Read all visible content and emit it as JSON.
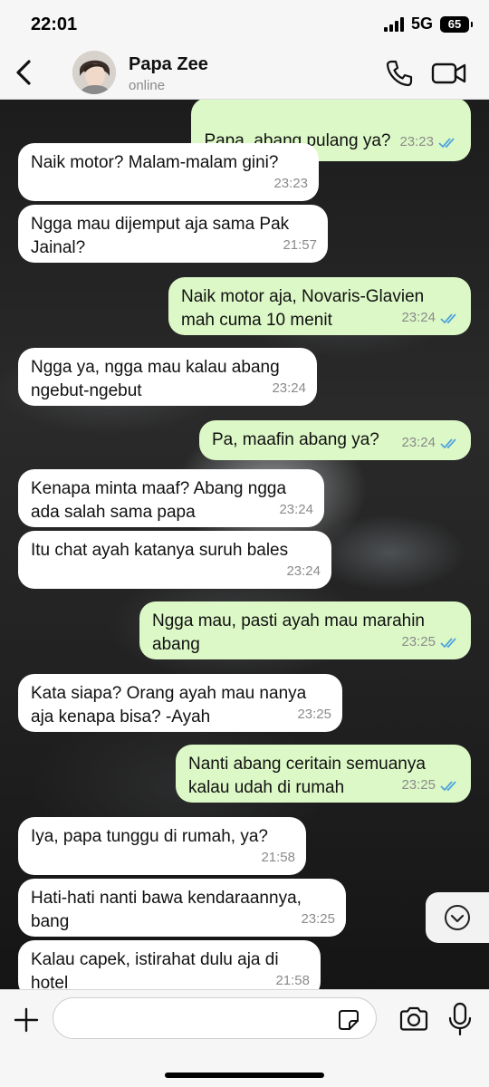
{
  "status_bar": {
    "time": "22:01",
    "network": "5G",
    "battery": "65"
  },
  "header": {
    "contact_name": "Papa Zee",
    "contact_status": "online"
  },
  "messages": [
    {
      "dir": "out",
      "text": "Papa, abang pulang ya?",
      "time": "23:23"
    },
    {
      "dir": "in",
      "text": "Naik motor? Malam-malam gini?",
      "time": "23:23"
    },
    {
      "dir": "in",
      "text": "Ngga mau dijemput aja sama Pak\nJainal?",
      "time": "21:57"
    },
    {
      "dir": "out",
      "text": "Naik motor aja, Novaris-Glavien\nmah cuma 10 menit",
      "time": "23:24"
    },
    {
      "dir": "in",
      "text": "Ngga ya, ngga mau kalau abang\nngebut-ngebut",
      "time": "23:24"
    },
    {
      "dir": "out",
      "text": "Pa, maafin abang ya?",
      "time": "23:24"
    },
    {
      "dir": "in",
      "text": "Kenapa minta maaf? Abang ngga\nada salah sama papa",
      "time": "23:24"
    },
    {
      "dir": "in",
      "text": "Itu chat ayah katanya suruh bales",
      "time": "23:24"
    },
    {
      "dir": "out",
      "text": "Ngga mau, pasti ayah mau marahin\nabang",
      "time": "23:25"
    },
    {
      "dir": "in",
      "text": "Kata siapa? Orang ayah mau nanya\naja kenapa bisa? -Ayah",
      "time": "23:25"
    },
    {
      "dir": "out",
      "text": "Nanti abang ceritain semuanya\nkalau udah di rumah",
      "time": "23:25"
    },
    {
      "dir": "in",
      "text": "Iya, papa tunggu di rumah, ya?",
      "time": "21:58"
    },
    {
      "dir": "in",
      "text": "Hati-hati nanti bawa kendaraannya,\nbang",
      "time": "23:25"
    },
    {
      "dir": "in",
      "text": "Kalau capek, istirahat dulu aja di\nhotel",
      "time": "21:58"
    }
  ],
  "composer": {
    "placeholder": ""
  },
  "icons": {
    "back": "chevron-left-icon",
    "call": "phone-icon",
    "video": "video-camera-icon",
    "scroll": "chevron-down-icon",
    "plus": "plus-icon",
    "sticker": "sticker-icon",
    "camera": "camera-icon",
    "mic": "microphone-icon",
    "read": "double-check-icon"
  },
  "colors": {
    "outgoing_bubble": "#dcf8c6",
    "incoming_bubble": "#ffffff",
    "read_ticks": "#4fa3e0"
  }
}
